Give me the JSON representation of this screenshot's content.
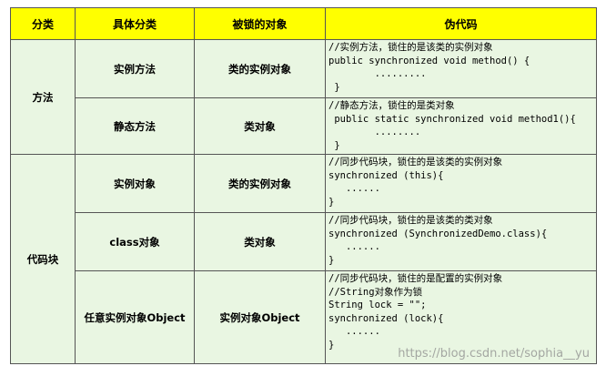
{
  "headers": [
    "分类",
    "具体分类",
    "被锁的对象",
    "伪代码"
  ],
  "groups": {
    "method": "方法",
    "code_block": "代码块"
  },
  "rows": [
    {
      "sub": "实例方法",
      "locked": "类的实例对象",
      "code": [
        "//实例方法，锁住的是该类的实例对象",
        "public synchronized void method() {",
        "        .........",
        " }"
      ]
    },
    {
      "sub": "静态方法",
      "locked": "类对象",
      "code": [
        "//静态方法，锁住的是类对象",
        " public static synchronized void method1(){",
        "        ........",
        " }"
      ]
    },
    {
      "sub": "实例对象",
      "locked": "类的实例对象",
      "code": [
        "//同步代码块，锁住的是该类的实例对象",
        "synchronized (this){",
        "   ......",
        "}"
      ]
    },
    {
      "sub": "class对象",
      "locked": "类对象",
      "code": [
        "//同步代码块，锁住的是该类的类对象",
        "synchronized (SynchronizedDemo.class){",
        "   ......",
        "}"
      ]
    },
    {
      "sub": "任意实例对象Object",
      "locked": "实例对象Object",
      "code": [
        "//同步代码块，锁住的是配置的实例对象",
        "//String对象作为锁",
        "String lock = \"\";",
        "synchronized (lock){",
        "   ......",
        "}"
      ]
    }
  ],
  "watermark": "https://blog.csdn.net/sophia__yu"
}
